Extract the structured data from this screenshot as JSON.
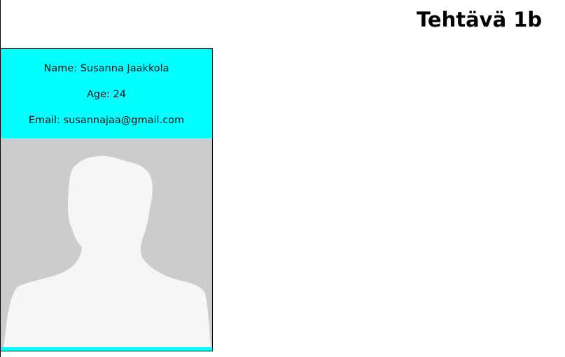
{
  "page": {
    "title": "Tehtävä 1b"
  },
  "card": {
    "name_label": "Name:",
    "name_value": "Susanna Jaakkola",
    "age_label": "Age:",
    "age_value": "24",
    "email_label": "Email:",
    "email_value": "susannajaa@gmail.com",
    "photo_icon": "person-silhouette-icon"
  },
  "colors": {
    "card_background": "#00ffff",
    "photo_background": "#cccccc",
    "silhouette": "#f5f7f7"
  }
}
